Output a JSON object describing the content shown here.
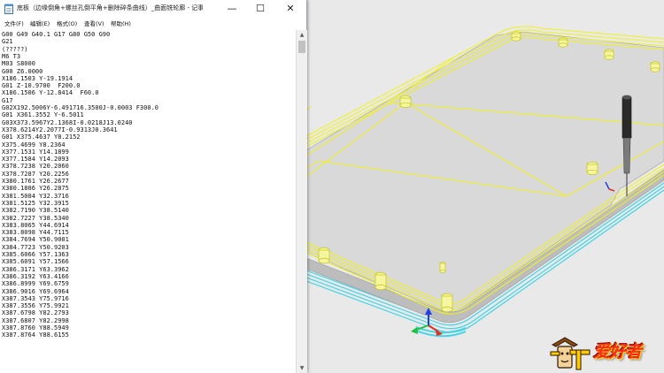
{
  "window": {
    "title": "底板（边缘倒角+螺丝孔倒平角+删除碎条曲线）_曲面铣轮廓 - 记事本",
    "minimize_icon": "minimize-icon",
    "maximize_icon": "maximize-icon",
    "close_icon": "close-icon"
  },
  "menu": {
    "items": [
      {
        "label": "文件(F)"
      },
      {
        "label": "编辑(E)"
      },
      {
        "label": "格式(O)"
      },
      {
        "label": "查看(V)"
      },
      {
        "label": "帮助(H)"
      }
    ]
  },
  "editor": {
    "lines": [
      "G00 G49 G40.1 G17 G80 G50 G90",
      "G21",
      "(?????)",
      "M6 T3",
      "M03 S8000",
      "G00 Z6.0000",
      "X186.1503 Y-19.1914",
      "G01 Z-10.9700  F200.0",
      "X186.1506 Y-12.8414  F60.0",
      "G17",
      "G02X192.5006Y-6.491716.3500J-0.0003 F300.0",
      "G01 X361.3552 Y-6.5011",
      "G03X373.5967Y2.1368I-0.0218J13.0240",
      "X378.6214Y2.2077I-0.9313J0.3641",
      "G01 X375.4637 Y8.2152",
      "X375.4699 Y8.2364",
      "X377.1531 Y14.1899",
      "X377.1584 Y14.2093",
      "X378.7238 Y20.2060",
      "X378.7287 Y20.2256",
      "X380.1761 Y26.2677",
      "X380.1806 Y26.2875",
      "X381.5084 Y32.3716",
      "X381.5125 Y32.3915",
      "X382.7190 Y38.5140",
      "X382.7227 Y38.5340",
      "X383.8065 Y44.6914",
      "X383.8098 Y44.7115",
      "X384.7694 Y50.9001",
      "X384.7723 Y50.9203",
      "X385.6066 Y57.1363",
      "X385.6091 Y57.1566",
      "X386.3171 Y63.3962",
      "X386.3192 Y63.4166",
      "X386.8999 Y69.6759",
      "X386.9016 Y69.6964",
      "X387.3543 Y75.9716",
      "X387.3556 Y75.9921",
      "X387.6798 Y82.2793",
      "X387.6807 Y82.2998",
      "X387.8760 Y88.5949",
      "X387.8764 Y88.6155"
    ]
  },
  "scrollbar": {
    "up_icon": "scroll-up-arrow-icon",
    "down_icon": "scroll-down-arrow-icon"
  },
  "logo": {
    "text": "爱好者",
    "icon": "carpenter-character-logo"
  },
  "colors": {
    "toolpath_yellow": "#f2f21a",
    "plate_gray": "#d9d9d9",
    "plate_side_gray": "#bdbdbd",
    "edge_cyan": "#3fd4e6",
    "background": "#e9e9e9",
    "axis_x": "#e03020",
    "axis_y": "#20c040",
    "axis_z": "#2040e0",
    "logo_red": "#ff2a1f"
  }
}
